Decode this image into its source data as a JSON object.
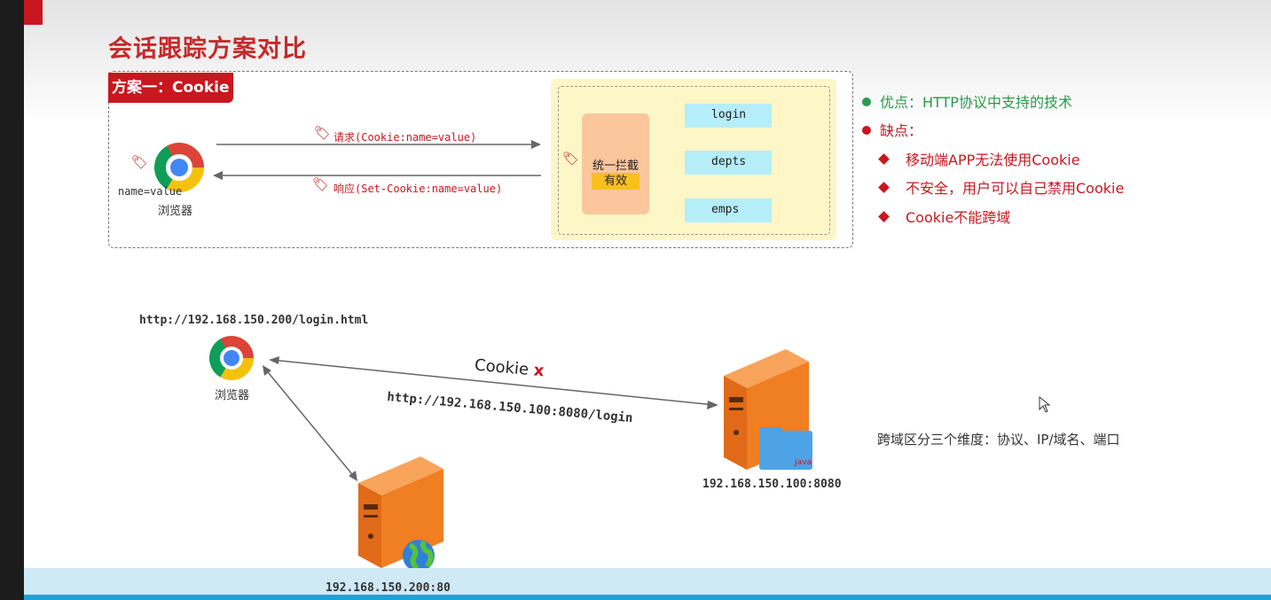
{
  "slide": {
    "title": "会话跟踪方案对比",
    "case_label": "方案一：Cookie"
  },
  "flow": {
    "request": "请求(Cookie:name=value)",
    "response": "响应(Set-Cookie:name=value)",
    "browser_value": "name=value",
    "browser_label": "浏览器",
    "filter_label": "统一拦截",
    "filter_valid": "有效",
    "routes": [
      "login",
      "depts",
      "emps"
    ]
  },
  "pros_cons": {
    "pro": "优点：HTTP协议中支持的技术",
    "con_heading": "缺点：",
    "cons": [
      "移动端APP无法使用Cookie",
      "不安全，用户可以自己禁用Cookie",
      "Cookie不能跨域"
    ]
  },
  "cross_domain": {
    "browser_url": "http://192.168.150.200/login.html",
    "browser_label": "浏览器",
    "cookie_label": "Cookie",
    "cookie_mark": "x",
    "request_url": "http://192.168.150.100:8080/login",
    "server_right": "192.168.150.100:8080",
    "server_bottom": "192.168.150.200:80",
    "note": "跨域区分三个维度：协议、IP/域名、端口",
    "java_label": "Java"
  },
  "colors": {
    "brand_red": "#c8171f",
    "pro_green": "#2a9a4a",
    "filter_orange": "#fbc69c",
    "route_cyan": "#b5edf9",
    "arrow_green": "#7cc043"
  }
}
